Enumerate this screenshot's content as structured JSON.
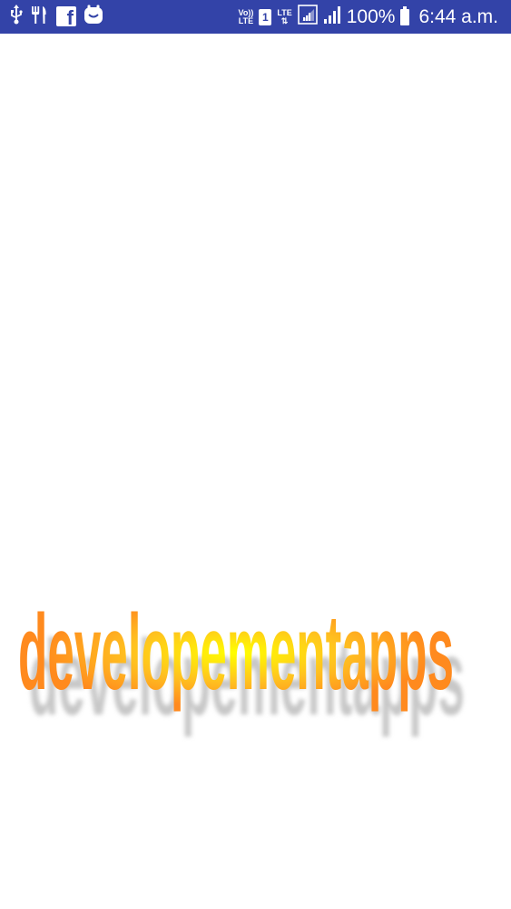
{
  "status_bar": {
    "notification_icons": [
      "usb-icon",
      "restaurant-icon",
      "facebook-icon",
      "app-notification-icon"
    ],
    "volte_top": "Vo))",
    "volte_bottom": "LTE",
    "sim_slot": "1",
    "lte_label": "LTE",
    "battery_percent": "100%",
    "time": "6:44 a.m."
  },
  "content": {
    "logo_text": "developementapps",
    "colors": {
      "status_bar_bg": "#3343a8",
      "logo_orange": "#ff8a1e",
      "logo_yellow": "#ffff00",
      "shadow_gray": "#c8c8c8"
    }
  }
}
